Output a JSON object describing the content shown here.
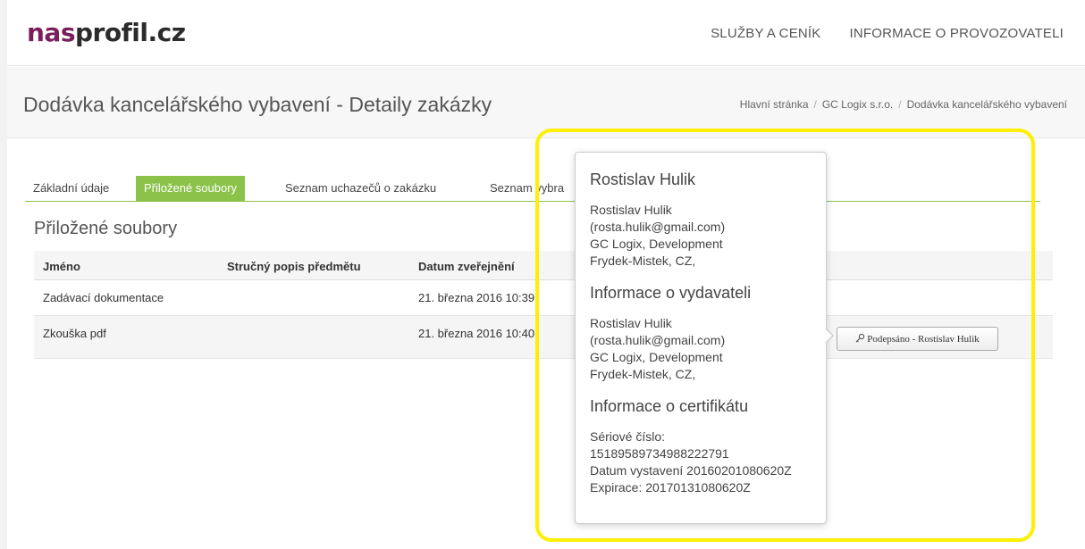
{
  "header": {
    "logo_part1": "nas",
    "logo_part2": "profil.cz",
    "nav": [
      "SLUŽBY A CENÍK",
      "INFORMACE O PROVOZOVATELI"
    ]
  },
  "titlebar": {
    "title": "Dodávka kancelářského vybavení - Detaily zakázky",
    "breadcrumb": [
      "Hlavní stránka",
      "GC Logix s.r.o.",
      "Dodávka kancelářského vybavení"
    ],
    "separator": "/"
  },
  "tabs": [
    "Základní údaje",
    "Přiložené soubory",
    "Seznam uchazečů o zakázku",
    "Seznam vybra"
  ],
  "section_title": "Přiložené soubory",
  "table": {
    "headers": [
      "Jméno",
      "Stručný popis předmětu",
      "Datum zveřejnění"
    ],
    "rows": [
      {
        "name": "Zadávací dokumentace",
        "desc": "",
        "date": "21. března 2016 10:39"
      },
      {
        "name": "Zkouška pdf",
        "desc": "",
        "date": "21. března 2016 10:40",
        "button": "Podepsáno - Rostislav Hulik"
      }
    ]
  },
  "popover": {
    "title": "Rostislav Hulik",
    "signer_lines": [
      "Rostislav Hulik",
      "(rosta.hulik@gmail.com)",
      "GC Logix, Development",
      "Frydek-Mistek, CZ,"
    ],
    "issuer_heading": "Informace o vydavateli",
    "issuer_lines": [
      "Rostislav Hulik",
      "(rosta.hulik@gmail.com)",
      "GC Logix, Development",
      "Frydek-Mistek, CZ,"
    ],
    "cert_heading": "Informace o certifikátu",
    "cert_lines": [
      "Sériové číslo:",
      "15189589734988222791",
      "Datum vystavení 20160201080620Z",
      "Expirace: 20170131080620Z"
    ]
  },
  "colors": {
    "logo_accent": "#7a1f5c",
    "tab_active": "#8bc34a",
    "highlight": "#ffef00"
  },
  "icons": {
    "sign_button_icon": "key-icon"
  }
}
